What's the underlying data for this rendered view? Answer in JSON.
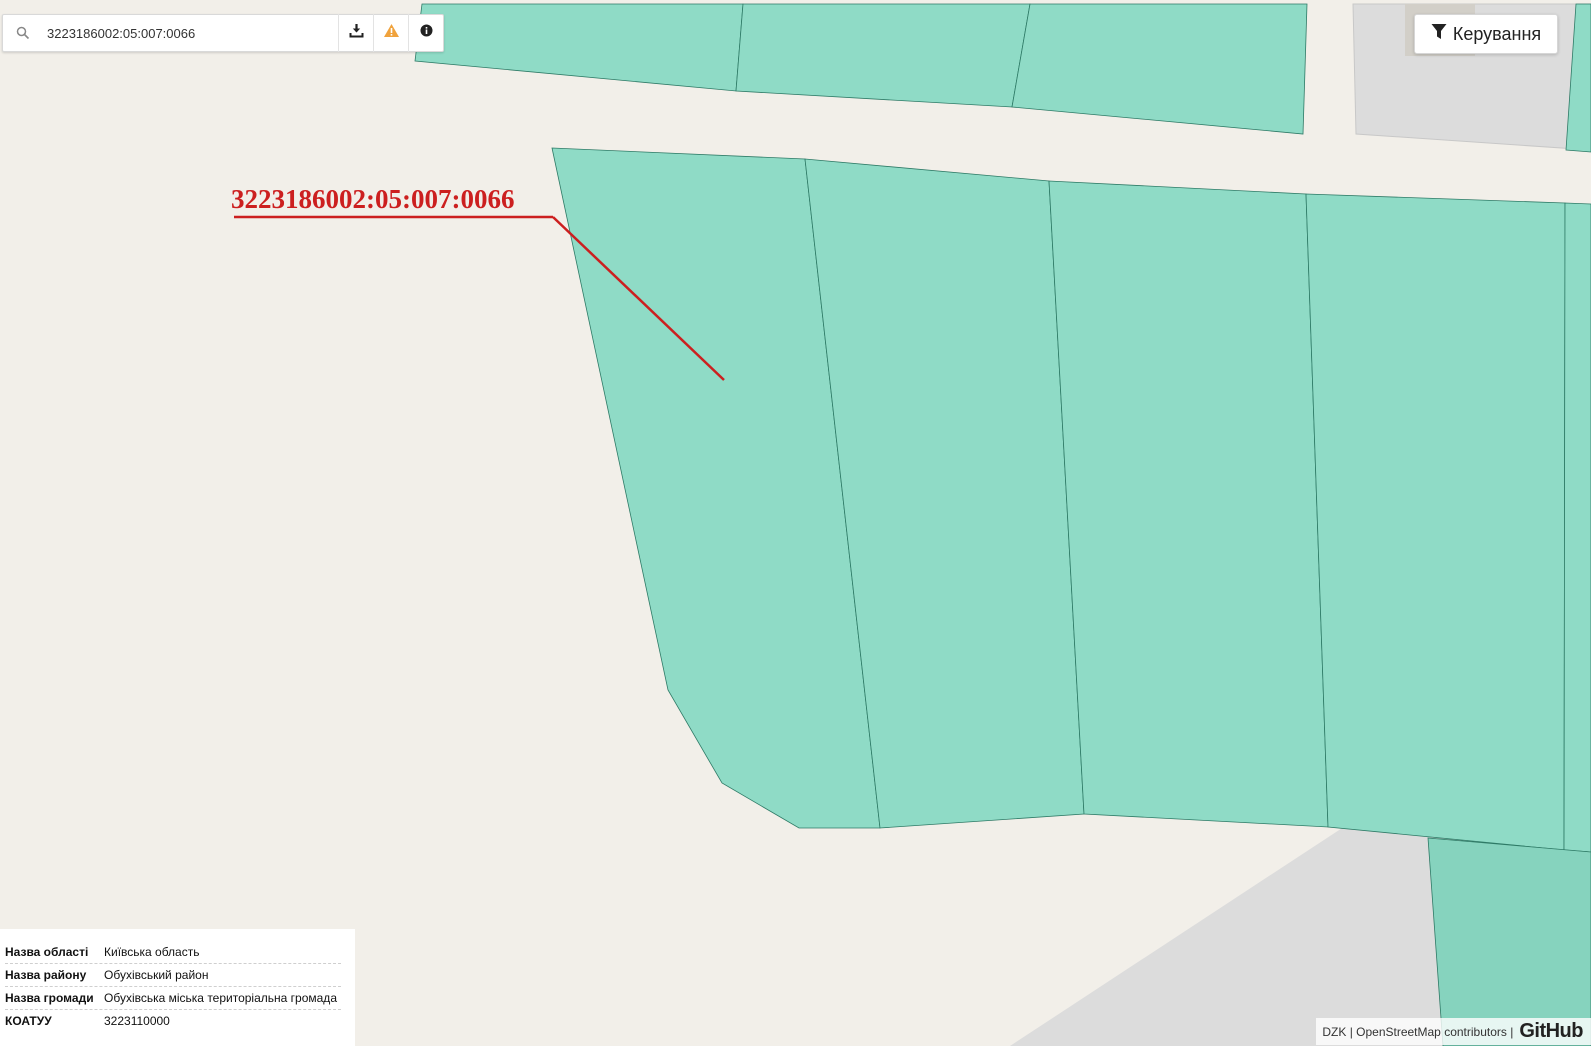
{
  "search": {
    "value": "3223186002:05:007:0066",
    "placeholder": ""
  },
  "toolbar": {
    "download_icon": "download-icon",
    "warning_icon": "warning-icon",
    "info_icon": "info-icon"
  },
  "control": {
    "label": "Керування",
    "icon": "filter-icon"
  },
  "map": {
    "parcel_label": "3223186002:05:007:0066",
    "label_color": "#cc1f1f",
    "parcel_fill": "#8fdbc6",
    "parcel_stroke": "#2e7a66",
    "background": "#f2efe9",
    "building_gray": "#dcdcdc"
  },
  "info": {
    "rows": [
      {
        "key": "Назва області",
        "value": "Київська область"
      },
      {
        "key": "Назва району",
        "value": "Обухівський район"
      },
      {
        "key": "Назва громади",
        "value": "Обухівська міська територіальна громада"
      },
      {
        "key": "КОАТУУ",
        "value": "3223110000"
      }
    ]
  },
  "attribution": {
    "text": "DZK | OpenStreetMap contributors |",
    "github": "GitHub"
  }
}
